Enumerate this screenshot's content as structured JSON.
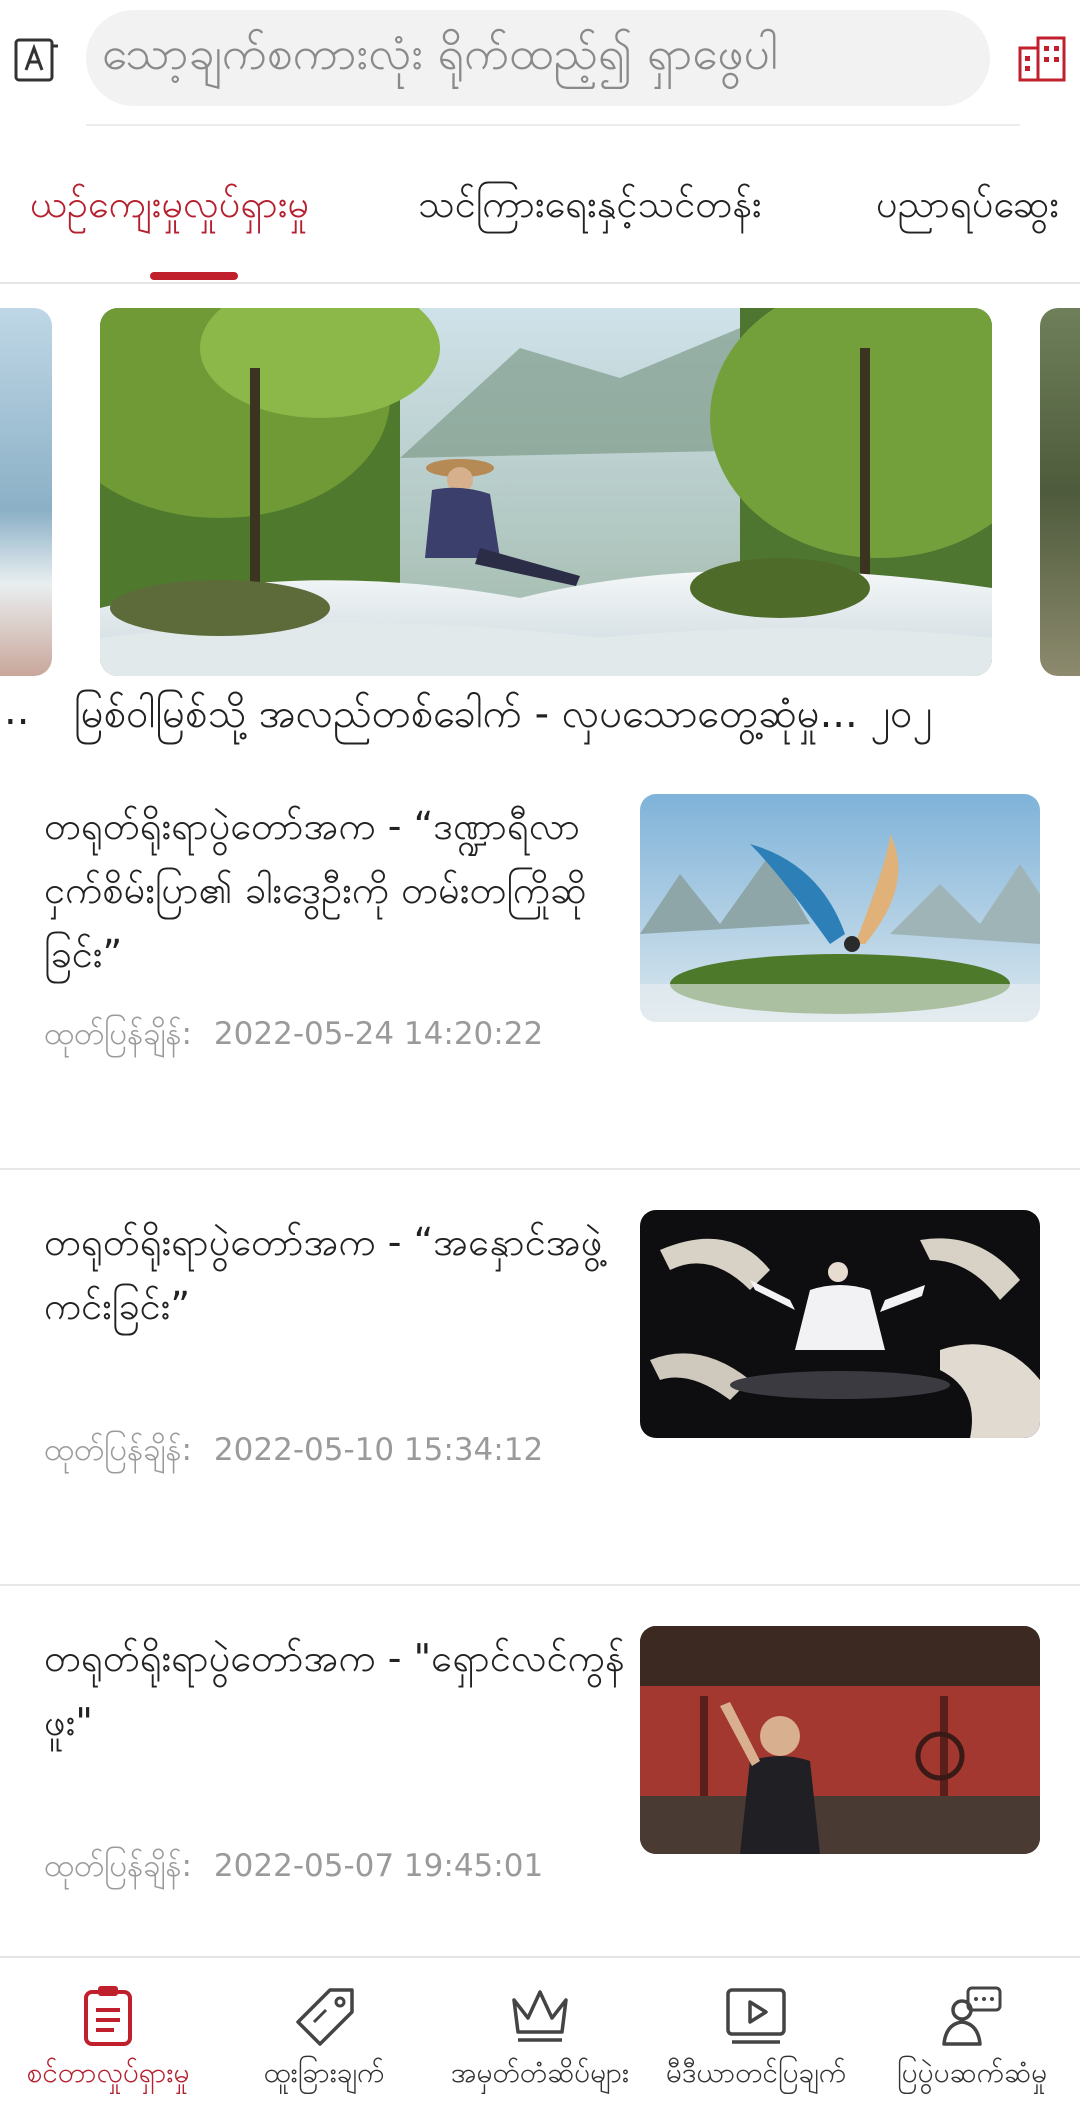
{
  "search": {
    "placeholder": "သော့ချက်စကားလုံး ရိုက်ထည့်၍ ရှာဖွေပါ"
  },
  "tabs": [
    {
      "label": "ယဉ်ကျေးမှုလှုပ်ရှားမှု",
      "active": true
    },
    {
      "label": "သင်ကြားရေးနှင့်သင်တန်း",
      "active": false
    },
    {
      "label": "ပညာရပ်ဆွေး",
      "active": false
    }
  ],
  "carousel": {
    "dots": "..",
    "caption": "မြစ်ဝါမြစ်သို့ အလည်တစ်ခေါက် - လှပသောတွေ့ဆုံမှု... ၂၀၂"
  },
  "articles": [
    {
      "title": "တရုတ်ရိုးရာပွဲတော်အက - “ဒဏ္ဍာရီလာ ငှက်စိမ်းပြာ၏ ခါးဒွေဦးကို တမ်းတကြိုဆိုခြင်း”",
      "meta_label": "ထုတ်ပြန်ချိန်:",
      "timestamp": "2022-05-24 14:20:22"
    },
    {
      "title": "တရုတ်ရိုးရာပွဲတော်အက - “အနှောင်အဖွဲ့ကင်းခြင်း”",
      "meta_label": "ထုတ်ပြန်ချိန်:",
      "timestamp": "2022-05-10 15:34:12"
    },
    {
      "title": "တရုတ်ရိုးရာပွဲတော်အက - \"ရှောင်လင်ကွန်ဖူး\"",
      "meta_label": "ထုတ်ပြန်ချိန်:",
      "timestamp": "2022-05-07 19:45:01"
    }
  ],
  "bottom_nav": [
    {
      "label": "စင်တာလှုပ်ရှားမှု",
      "icon": "clipboard-icon",
      "active": true
    },
    {
      "label": "ထူးခြားချက်",
      "icon": "tag-icon",
      "active": false
    },
    {
      "label": "အမှတ်တံဆိပ်များ",
      "icon": "crown-icon",
      "active": false
    },
    {
      "label": "မီဒီယာတင်ပြချက်",
      "icon": "video-play-icon",
      "active": false
    },
    {
      "label": "ပြပွဲပဆက်ဆံမှု",
      "icon": "chat-person-icon",
      "active": false
    }
  ],
  "colors": {
    "accent": "#b51f2e",
    "muted_text": "#9a9a9a",
    "search_bg": "#f2f2f2"
  }
}
